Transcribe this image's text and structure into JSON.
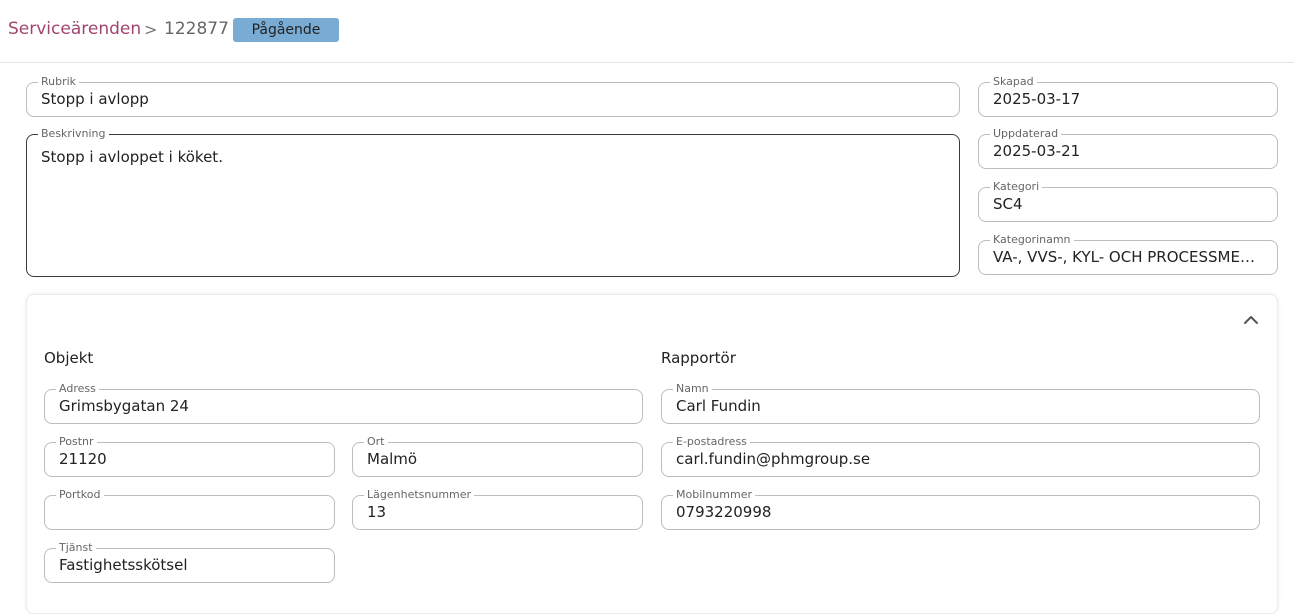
{
  "breadcrumb": {
    "parent": "Serviceärenden",
    "separator": ">",
    "id": "122877",
    "status": "Pågående"
  },
  "colors": {
    "accent": "#a0456e",
    "status_badge": "#79acd4"
  },
  "ticket": {
    "rubrik": {
      "label": "Rubrik",
      "value": "Stopp i avlopp"
    },
    "beskrivning": {
      "label": "Beskrivning",
      "value": "Stopp i avloppet i köket."
    },
    "skapad": {
      "label": "Skapad",
      "value": "2025-03-17"
    },
    "uppdaterad": {
      "label": "Uppdaterad",
      "value": "2025-03-21"
    },
    "kategori": {
      "label": "Kategori",
      "value": "SC4"
    },
    "kategorinamn": {
      "label": "Kategorinamn",
      "value": "VA-, VVS-, KYL- OCH PROCESSMEDIESYSTEM"
    }
  },
  "details": {
    "collapse_icon": "chevron-up-icon",
    "objekt": {
      "title": "Objekt",
      "adress": {
        "label": "Adress",
        "value": "Grimsbygatan 24"
      },
      "postnr": {
        "label": "Postnr",
        "value": "21120"
      },
      "ort": {
        "label": "Ort",
        "value": "Malmö"
      },
      "portkod": {
        "label": "Portkod",
        "value": ""
      },
      "lagenhetsnummer": {
        "label": "Lägenhetsnummer",
        "value": "13"
      },
      "tjanst": {
        "label": "Tjänst",
        "value": "Fastighetsskötsel"
      }
    },
    "rapportor": {
      "title": "Rapportör",
      "namn": {
        "label": "Namn",
        "value": "Carl Fundin"
      },
      "epost": {
        "label": "E-postadress",
        "value": "carl.fundin@phmgroup.se"
      },
      "mobil": {
        "label": "Mobilnummer",
        "value": "0793220998"
      }
    }
  }
}
